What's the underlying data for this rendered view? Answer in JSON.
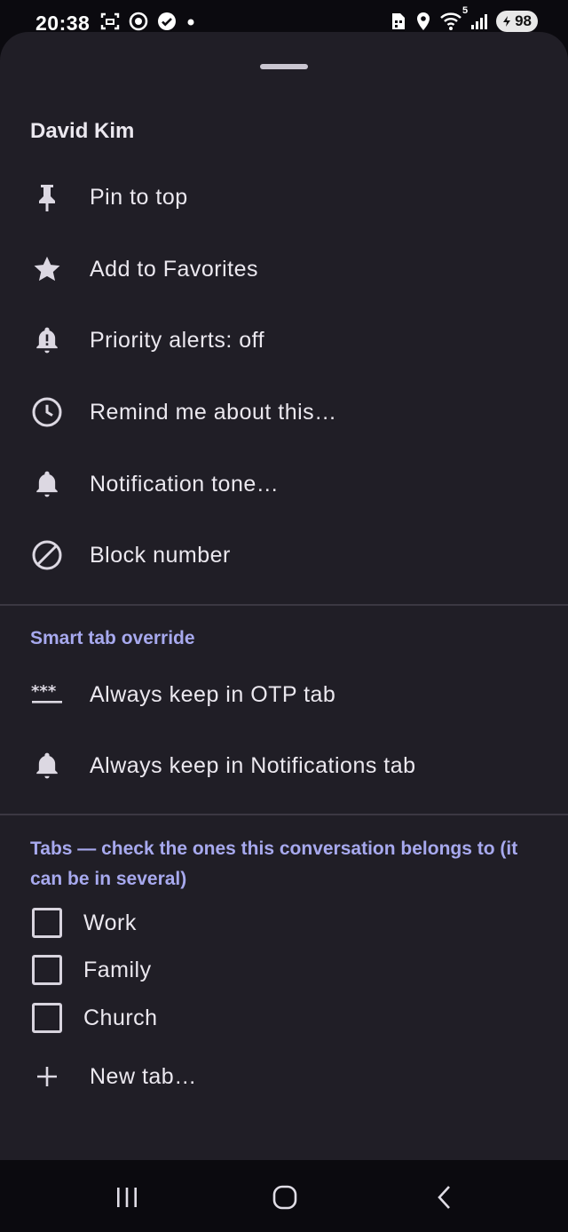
{
  "status_bar": {
    "time": "20:38",
    "left_icons": [
      "screenshot-icon",
      "vpn-icon",
      "check-circle-icon",
      "dot-icon"
    ],
    "right_icons": [
      "sim-icon",
      "location-icon",
      "wifi-icon",
      "signal-icon"
    ],
    "wifi_badge": "5",
    "battery_level": "98"
  },
  "sheet": {
    "contact_name": "David Kim",
    "menu_items": [
      {
        "label": "Pin to top",
        "icon": "pin-icon"
      },
      {
        "label": "Add to Favorites",
        "icon": "star-icon"
      },
      {
        "label": "Priority alerts: off",
        "icon": "priority-bell-icon"
      },
      {
        "label": "Remind me about this…",
        "icon": "clock-icon"
      },
      {
        "label": "Notification tone…",
        "icon": "bell-icon"
      },
      {
        "label": "Block number",
        "icon": "block-icon"
      }
    ],
    "smart_tab": {
      "title": "Smart tab override",
      "items": [
        {
          "label": "Always keep in OTP tab",
          "icon": "password-icon"
        },
        {
          "label": "Always keep in Notifications tab",
          "icon": "bell-icon"
        }
      ]
    },
    "tabs": {
      "title": "Tabs — check the ones this conversation belongs to (it can be in several)",
      "items": [
        {
          "label": "Work",
          "checked": false
        },
        {
          "label": "Family",
          "checked": false
        },
        {
          "label": "Church",
          "checked": false
        }
      ],
      "new_tab_label": "New tab…"
    }
  },
  "navigation": {
    "buttons": [
      "recent-apps-icon",
      "home-icon",
      "back-icon"
    ]
  },
  "colors": {
    "sheet_background": "#201e26",
    "accent": "#a7a9ee",
    "text": "#ebe8ef"
  }
}
